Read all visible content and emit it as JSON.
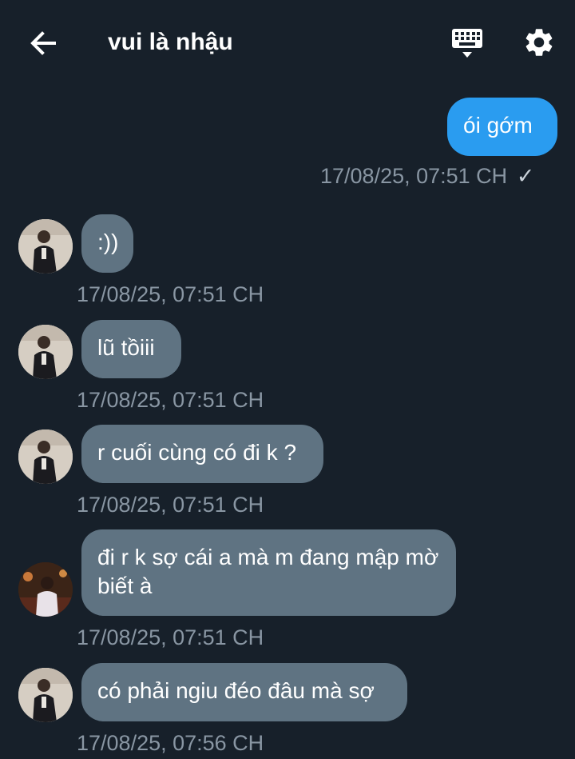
{
  "header": {
    "title": "vui là nhậu",
    "back_icon": "arrow-left-icon",
    "keyboard_icon": "keyboard-icon",
    "settings_icon": "gear-icon"
  },
  "colors": {
    "background": "#17202a",
    "incoming_bubble": "#5f7382",
    "outgoing_bubble": "#2a9cf0",
    "timestamp": "#8996a3"
  },
  "messages": [
    {
      "direction": "outgoing",
      "text": "ói gớm",
      "timestamp": "17/08/25, 07:51 CH",
      "status": "✓"
    },
    {
      "direction": "incoming",
      "text": ":))",
      "timestamp": "17/08/25, 07:51 CH"
    },
    {
      "direction": "incoming",
      "text": "lũ tồiii",
      "timestamp": "17/08/25, 07:51 CH"
    },
    {
      "direction": "incoming",
      "text": "r cuối cùng có đi k ?",
      "timestamp": "17/08/25, 07:51 CH"
    },
    {
      "direction": "incoming",
      "text": "đi r k sợ cái a mà m đang mập mờ biết à",
      "timestamp": "17/08/25, 07:51 CH"
    },
    {
      "direction": "incoming",
      "text": "có phải ngiu đéo đâu mà sợ",
      "timestamp": "17/08/25, 07:56 CH"
    }
  ]
}
